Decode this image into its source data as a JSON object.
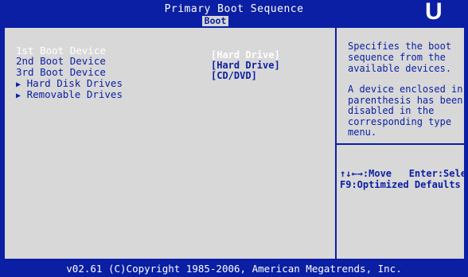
{
  "header": {
    "title": "Primary Boot Sequence",
    "active_tab": "Boot"
  },
  "logo": {
    "icon": "u-logo-icon",
    "color": "#ffffff"
  },
  "boot_devices": [
    {
      "label": "1st Boot Device",
      "value": "[Hard Drive]",
      "selected": true
    },
    {
      "label": "2nd Boot Device",
      "value": "[Hard Drive]",
      "selected": false
    },
    {
      "label": "3rd Boot Device",
      "value": "[CD/DVD]",
      "selected": false
    }
  ],
  "submenus": [
    {
      "label": "Hard Disk Drives",
      "icon": "triangle-right-icon"
    },
    {
      "label": "Removable Drives",
      "icon": "triangle-right-icon"
    }
  ],
  "help": {
    "line1": "Specifies the boot",
    "line2": "sequence from the",
    "line3": "available devices.",
    "line4": "A device enclosed in",
    "line5": "parenthesis has been",
    "line6": "disabled in the",
    "line7": "corresponding type",
    "line8": "menu."
  },
  "keys": {
    "line1": "↑↓←→:Move   Enter:Select",
    "line2": "F9:Optimized Defaults"
  },
  "footer": {
    "text": "v02.61 (C)Copyright 1985-2006, American Megatrends, Inc."
  },
  "colors": {
    "bios_blue": "#0a1fa3",
    "panel_gray": "#d8d8d8",
    "highlight_white": "#ffffff"
  }
}
